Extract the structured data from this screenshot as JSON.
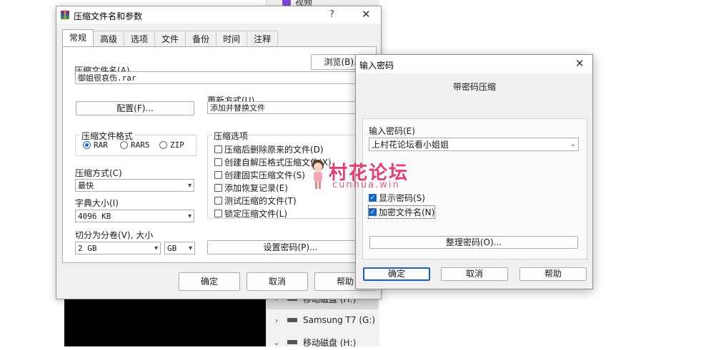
{
  "background": {
    "top_item": "视频",
    "tree_rows": [
      {
        "chevron": "›",
        "label": "移动磁盘 (H:)"
      },
      {
        "chevron": "›",
        "label": "Samsung T7 (G:)"
      },
      {
        "chevron": "⌄",
        "label": "移动磁盘 (H:)"
      }
    ]
  },
  "archive_dialog": {
    "title": "压缩文件名和参数",
    "help": "?",
    "close": "✕",
    "tabs": [
      "常规",
      "高级",
      "选项",
      "文件",
      "备份",
      "时间",
      "注释"
    ],
    "filename_label": "压缩文件名(A)",
    "browse_button": "浏览(B)...",
    "filename_value": "御姐很哀伤.rar",
    "update_label": "更新方式(U)",
    "profile_button": "配置(F)...",
    "update_value": "添加并替换文件",
    "format_group": "压缩文件格式",
    "formats": [
      "RAR",
      "RAR5",
      "ZIP"
    ],
    "options_group": "压缩选项",
    "options": [
      "压缩后删除原来的文件(D)",
      "创建自解压格式压缩文件(X)",
      "创建固实压缩文件(S)",
      "添加恢复记录(E)",
      "测试压缩的文件(T)",
      "锁定压缩文件(L)"
    ],
    "method_label": "压缩方式(C)",
    "method_value": "最快",
    "dict_label": "字典大小(I)",
    "dict_value": "4096 KB",
    "split_label": "切分为分卷(V), 大小",
    "split_value": "2 GB",
    "split_unit": "GB",
    "password_button": "设置密码(P)...",
    "ok": "确定",
    "cancel": "取消",
    "helpbtn": "帮助"
  },
  "password_dialog": {
    "title": "输入密码",
    "close": "✕",
    "heading": "带密码压缩",
    "input_label": "输入密码(E)",
    "password_value": "上村花论坛看小姐姐",
    "show_password": "显示密码(S)",
    "encrypt_names": "加密文件名(N)",
    "organize_button": "整理密码(O)...",
    "ok": "确定",
    "cancel": "取消",
    "help": "帮助"
  },
  "watermark": {
    "text": "村花论坛",
    "sub": "cunhua.win"
  },
  "colors": {
    "accent": "#1666c2",
    "watermark": "#e0407a"
  }
}
